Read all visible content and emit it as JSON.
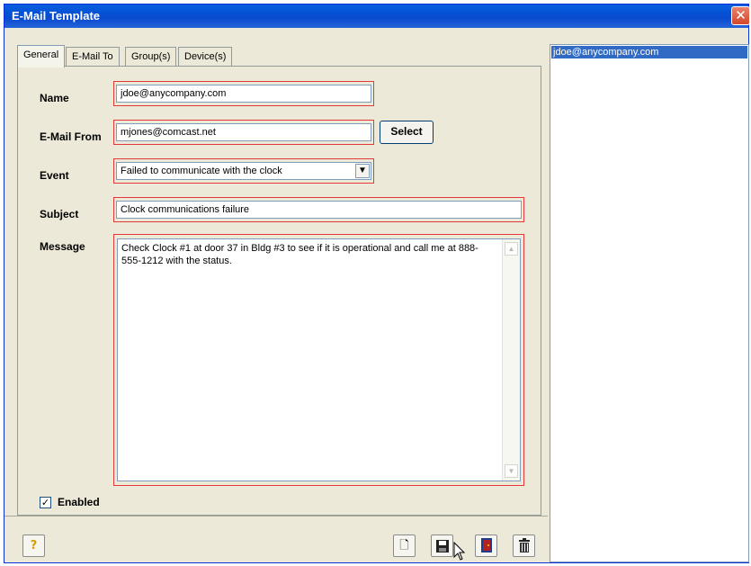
{
  "window": {
    "title": "E-Mail Template",
    "close_glyph": "✕"
  },
  "tabs": [
    {
      "label": "General",
      "active": true
    },
    {
      "label": "E-Mail To",
      "active": false
    },
    {
      "label": "Group(s)",
      "active": false
    },
    {
      "label": "Device(s)",
      "active": false
    }
  ],
  "form": {
    "name_label": "Name",
    "name_value": "jdoe@anycompany.com",
    "from_label": "E-Mail From",
    "from_value": "mjones@comcast.net",
    "select_label": "Select",
    "event_label": "Event",
    "event_value": "Failed to communicate with the clock",
    "subject_label": "Subject",
    "subject_value": "Clock communications failure",
    "message_label": "Message",
    "message_value": "Check Clock #1 at door 37 in Bldg #3 to see if it is operational and call me at 888-555-1212 with the status.",
    "enabled_label": "Enabled",
    "enabled_checked": true
  },
  "toolbar": {
    "help_icon": "help-icon",
    "new_icon": "new-document-icon",
    "save_icon": "save-disk-icon",
    "exit_icon": "exit-door-icon",
    "delete_icon": "trash-icon"
  },
  "list": {
    "items": [
      "jdoe@anycompany.com"
    ]
  },
  "colors": {
    "title_bar": "#0450d3",
    "highlight_border": "#e23a3a",
    "selection": "#316ac5",
    "panel": "#ece9d8"
  }
}
